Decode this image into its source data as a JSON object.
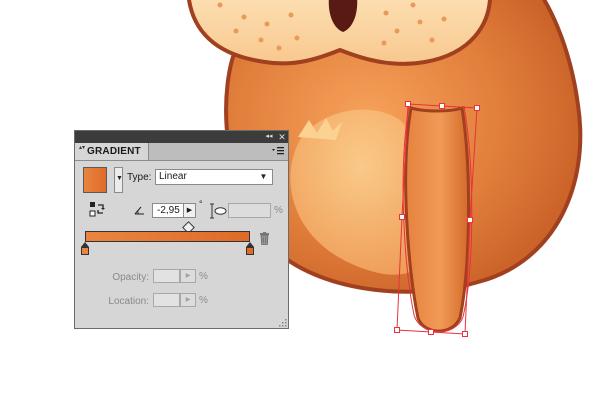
{
  "panel": {
    "tab_label": "GRADIENT",
    "collapse_glyph": "◂◂",
    "close_glyph": "✕",
    "tab_arrows": "▴▾",
    "type_label": "Type:",
    "type_value": "Linear",
    "dropdown_glyph": "▼",
    "angle_value": "-2,95",
    "stepper_glyph": "▶",
    "degree_symbol": "°",
    "aspect_unit": "%",
    "opacity_label": "Opacity:",
    "opacity_unit": "%",
    "location_label": "Location:",
    "location_unit": "%"
  },
  "gradient": {
    "start_color": "#e8853f",
    "end_color": "#e06a28",
    "midpoint_percent": 50
  },
  "colors": {
    "panel_bg": "#d6d6d6",
    "titlebar": "#3c3c3c",
    "walrus_body": "#d9722f",
    "walrus_outline": "#a0401e",
    "walrus_belly": "#fbc078",
    "walrus_muzzle": "#fbd4a0",
    "selection": "#e8323c"
  }
}
